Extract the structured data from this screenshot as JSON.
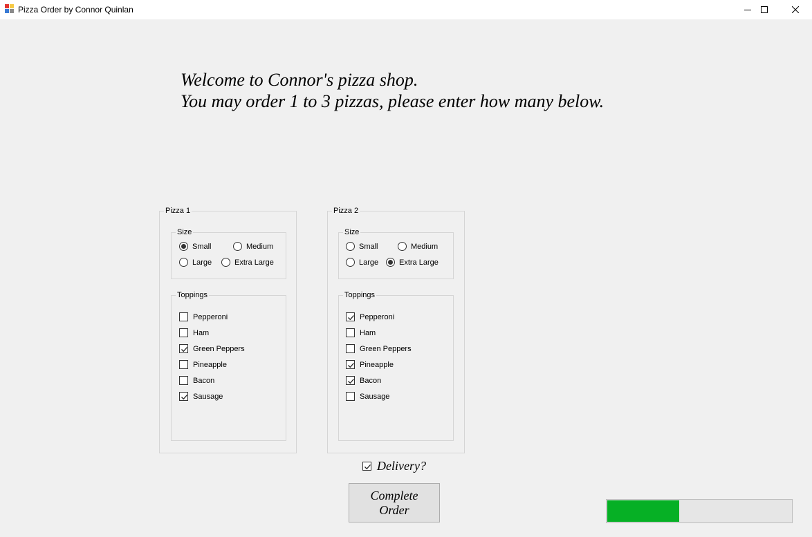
{
  "window": {
    "title": "Pizza Order by Connor Quinlan",
    "icon": "app-icon",
    "controls": [
      "minimize-icon",
      "maximize-icon",
      "close-icon"
    ]
  },
  "welcome": {
    "line1": "Welcome to Connor's pizza shop.",
    "line2": "You may order 1 to 3 pizzas, please enter how many below."
  },
  "pizzas": [
    {
      "title": "Pizza 1",
      "size_label": "Size",
      "sizes": [
        {
          "label": "Small",
          "checked": true
        },
        {
          "label": "Medium",
          "checked": false
        },
        {
          "label": "Large",
          "checked": false
        },
        {
          "label": "Extra Large",
          "checked": false
        }
      ],
      "toppings_label": "Toppings",
      "toppings": [
        {
          "label": "Pepperoni",
          "checked": false
        },
        {
          "label": "Ham",
          "checked": false
        },
        {
          "label": "Green Peppers",
          "checked": true
        },
        {
          "label": "Pineapple",
          "checked": false
        },
        {
          "label": "Bacon",
          "checked": false
        },
        {
          "label": "Sausage",
          "checked": true
        }
      ]
    },
    {
      "title": "Pizza 2",
      "size_label": "Size",
      "sizes": [
        {
          "label": "Small",
          "checked": false
        },
        {
          "label": "Medium",
          "checked": false
        },
        {
          "label": "Large",
          "checked": false
        },
        {
          "label": "Extra Large",
          "checked": true
        }
      ],
      "toppings_label": "Toppings",
      "toppings": [
        {
          "label": "Pepperoni",
          "checked": true
        },
        {
          "label": "Ham",
          "checked": false
        },
        {
          "label": "Green Peppers",
          "checked": false
        },
        {
          "label": "Pineapple",
          "checked": true
        },
        {
          "label": "Bacon",
          "checked": true
        },
        {
          "label": "Sausage",
          "checked": false
        }
      ]
    }
  ],
  "delivery": {
    "label": "Delivery?",
    "checked": true
  },
  "complete_button": {
    "label": "Complete Order"
  },
  "progress": {
    "fraction": 0.39,
    "color": "#06b025"
  }
}
